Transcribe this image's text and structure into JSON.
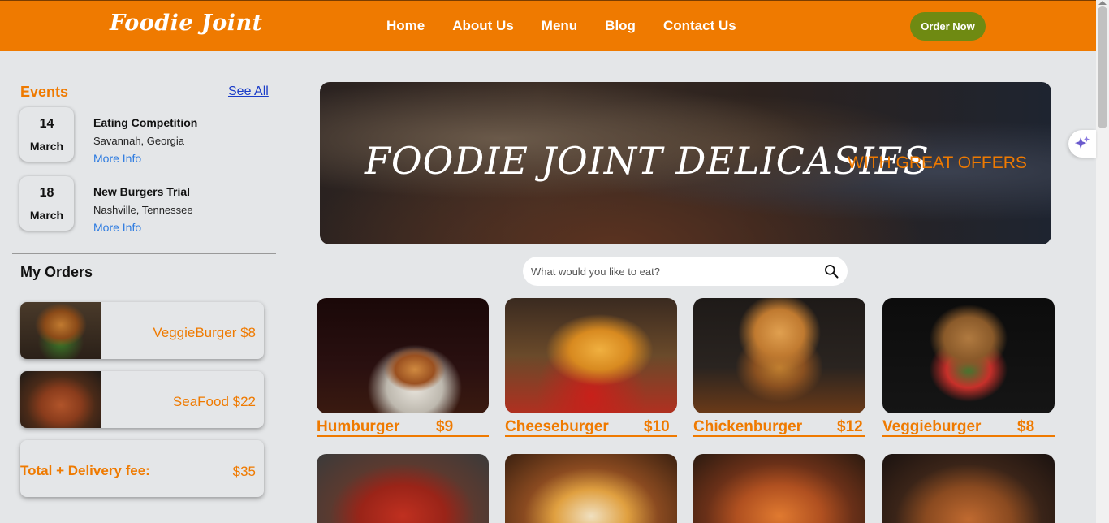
{
  "header": {
    "logo": "Foodie Joint",
    "nav": [
      "Home",
      "About Us",
      "Menu",
      "Blog",
      "Contact Us"
    ],
    "order_button": "Order Now"
  },
  "sidebar": {
    "events_title": "Events",
    "see_all": "See All",
    "events": [
      {
        "day": "14",
        "month": "March",
        "name": "Eating Competition",
        "place": "Savannah, Georgia",
        "more": "More Info"
      },
      {
        "day": "18",
        "month": "March",
        "name": "New Burgers Trial",
        "place": "Nashville, Tennessee",
        "more": "More Info"
      }
    ],
    "orders_title": "My Orders",
    "orders": [
      {
        "label": "VeggieBurger $8"
      },
      {
        "label": "SeaFood $22"
      }
    ],
    "total_label": "Total + Delivery fee:",
    "total_value": "$35"
  },
  "hero": {
    "title": "FOODIE JOINT DELICASIES",
    "subtitle": "WITH GREAT OFFERS"
  },
  "search": {
    "placeholder": "What would you like to eat?"
  },
  "menu": [
    {
      "name": "Humburger",
      "price": "$9"
    },
    {
      "name": "Cheeseburger",
      "price": "$10"
    },
    {
      "name": "Chickenburger",
      "price": "$12"
    },
    {
      "name": "Veggieburger",
      "price": "$8"
    }
  ],
  "colors": {
    "brand": "#ef7a00",
    "order_button": "#6f8a12",
    "link": "#2d7be0",
    "background": "#e4e6e8"
  }
}
